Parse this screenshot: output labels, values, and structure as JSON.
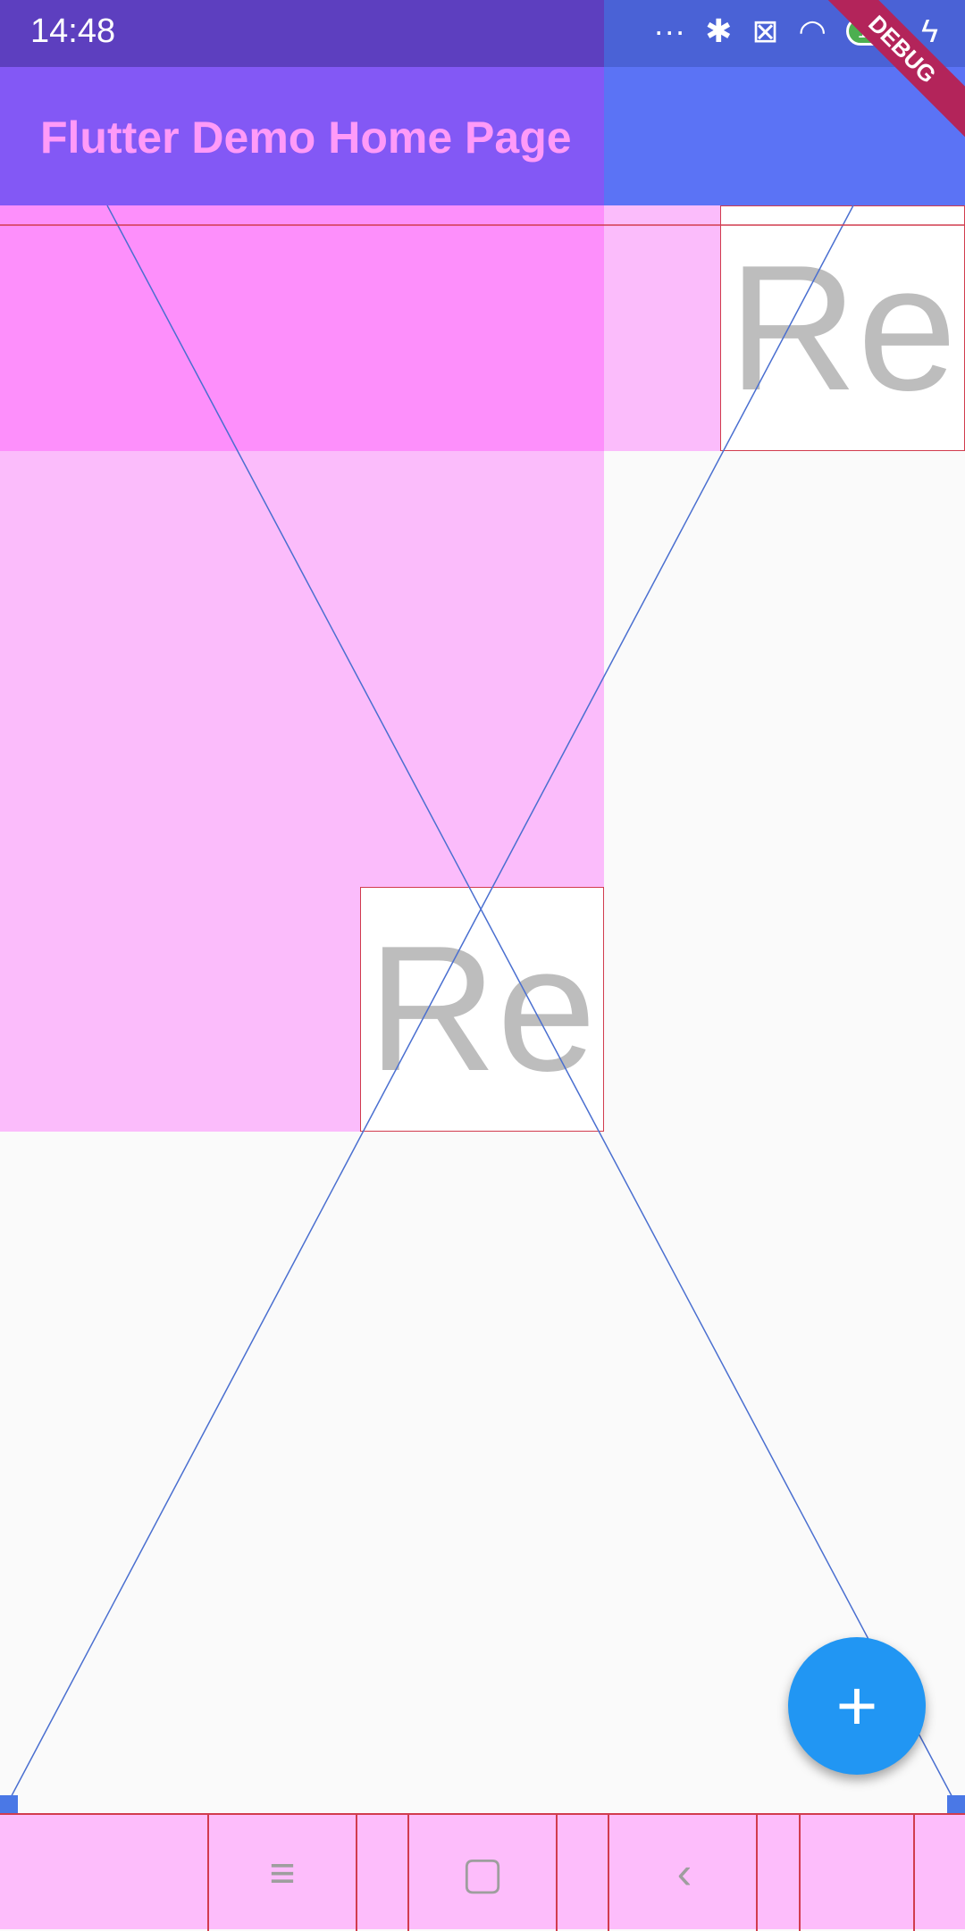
{
  "status_bar": {
    "time": "14:48",
    "icons": [
      "dots-icon",
      "bluetooth-icon",
      "sim-off-icon",
      "wifi-icon",
      "battery-icon",
      "charging-icon"
    ],
    "battery_level": "100"
  },
  "app_bar": {
    "title": "Flutter Demo Home Page"
  },
  "debug_banner": "DEBUG",
  "boxes": {
    "top_right_text": "Re",
    "center_text": "Re"
  },
  "fab": {
    "icon": "plus-icon",
    "label": "+"
  },
  "nav_bar": {
    "menu_icon": "≡",
    "home_icon": "▢",
    "back_icon": "‹"
  },
  "colors": {
    "status_bar": "#5d3fbf",
    "app_bar": "#8358f5",
    "title": "#ff9af8",
    "magenta": "#fd8ffb",
    "pink": "#fbbcfb",
    "fab": "#2196f3",
    "guide": "#4a6fd0",
    "debug_red": "#d13c4e"
  }
}
